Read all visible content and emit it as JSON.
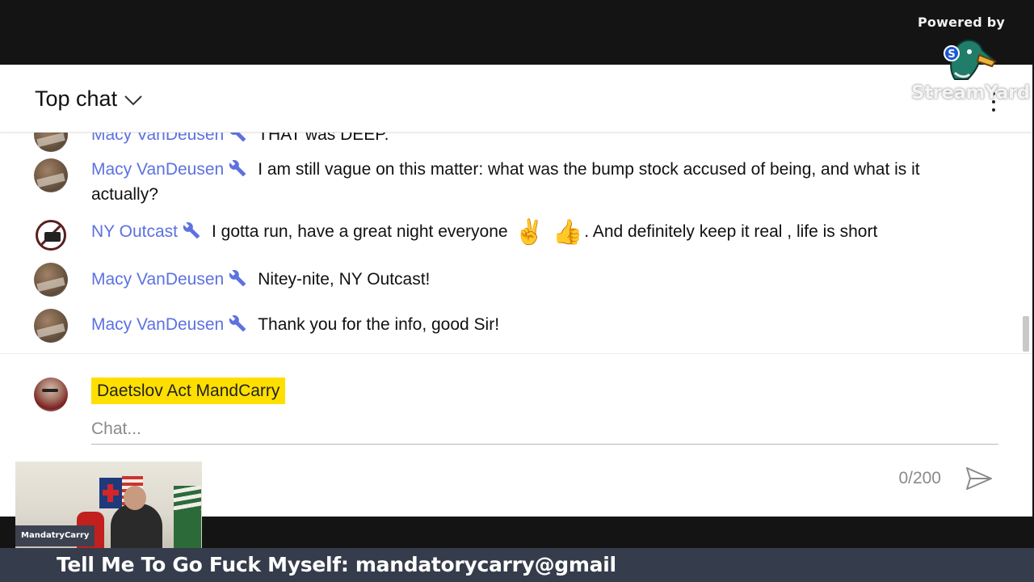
{
  "overlay": {
    "powered_by": "Powered by",
    "brand_logo_text": "StreamYard",
    "ticker_text": "Tell Me To Go Fuck Myself: mandatorycarry@gmail",
    "webcam_name_tag": "MandatryCarry"
  },
  "chat": {
    "header_title": "Top chat",
    "messages": [
      {
        "author": "Macy VanDeusen",
        "role_icon": "wrench-icon",
        "text": "THAT was DEEP."
      },
      {
        "author": "Macy VanDeusen",
        "role_icon": "wrench-icon",
        "text": "I am still vague on this matter: what was the bump stock accused of being, and what is it actually?"
      },
      {
        "author": "NY Outcast",
        "role_icon": "wrench-icon",
        "text_before": "I gotta run, have a great night everyone",
        "emoji_1": "✌",
        "emoji_2": "👍",
        "text_after": ". And definitely keep it real , life is short"
      },
      {
        "author": "Macy VanDeusen",
        "role_icon": "wrench-icon",
        "text": "Nitey-nite, NY Outcast!"
      },
      {
        "author": "Macy VanDeusen",
        "role_icon": "wrench-icon",
        "text": "Thank you for the info, good Sir!"
      }
    ],
    "composer": {
      "current_user": "Daetslov Act MandCarry",
      "input_value": "",
      "input_placeholder": "Chat...",
      "char_count": "0/200"
    }
  },
  "colors": {
    "author_name": "#5c72e0",
    "name_highlight": "#ffdf00",
    "ticker_bg": "#353c4b"
  }
}
